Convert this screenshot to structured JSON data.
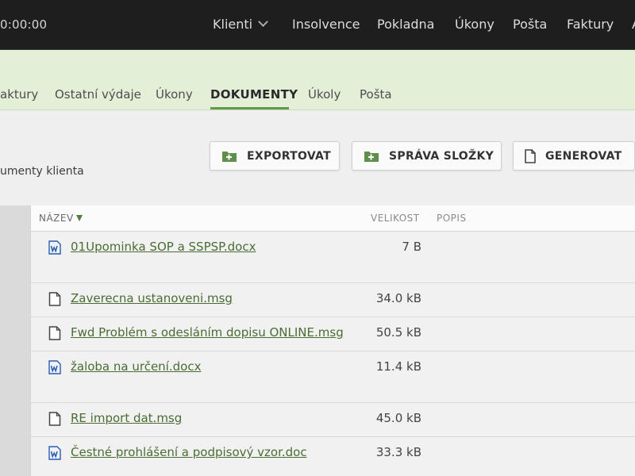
{
  "topnav": {
    "timer": "0:00:00",
    "items": [
      {
        "label": "Klienti",
        "has_dropdown": true
      },
      {
        "label": "Insolvence"
      },
      {
        "label": "Pokladna"
      },
      {
        "label": "Úkony"
      },
      {
        "label": "Pošta"
      },
      {
        "label": "Faktury"
      }
    ],
    "cut_item": "A"
  },
  "tabs": [
    {
      "label": "aktury"
    },
    {
      "label": "Ostatní výdaje"
    },
    {
      "label": "Úkony"
    },
    {
      "label": "DOKUMENTY",
      "active": true
    },
    {
      "label": "Úkoly"
    },
    {
      "label": "Pošta"
    }
  ],
  "toolbar": {
    "subtitle": "umenty klienta",
    "buttons": [
      {
        "label": "EXPORTOVAT",
        "icon": "folder-export-icon"
      },
      {
        "label": "SPRÁVA SLOŽKY",
        "icon": "folder-manage-icon"
      },
      {
        "label": "GENEROVAT",
        "icon": "document-icon"
      }
    ]
  },
  "table": {
    "headers": {
      "name": "NÁZEV",
      "size": "VELIKOST",
      "description": "POPIS"
    },
    "sort_column": "name",
    "rows": [
      {
        "name": "01Upominka SOP a SSPSP.docx",
        "size": "7 B",
        "icon": "word-document-icon"
      },
      {
        "name": "Zaverecna ustanoveni.msg",
        "size": "34.0 kB",
        "icon": "file-icon"
      },
      {
        "name": "Fwd Problém s odesláním dopisu ONLINE.msg",
        "size": "50.5 kB",
        "icon": "file-icon"
      },
      {
        "name": "žaloba na určení.docx",
        "size": "11.4 kB",
        "icon": "word-document-icon"
      },
      {
        "name": "RE import dat.msg",
        "size": "45.0 kB",
        "icon": "file-icon"
      },
      {
        "name": "Čestné prohlášení a podpisový vzor.doc",
        "size": "33.3 kB",
        "icon": "word-document-icon"
      }
    ]
  },
  "colors": {
    "topbar": "#1e1e1e",
    "tab_band": "#e4efd8",
    "accent": "#5f9b4b",
    "link": "#4a6d33",
    "word_icon": "#2b5cab"
  }
}
